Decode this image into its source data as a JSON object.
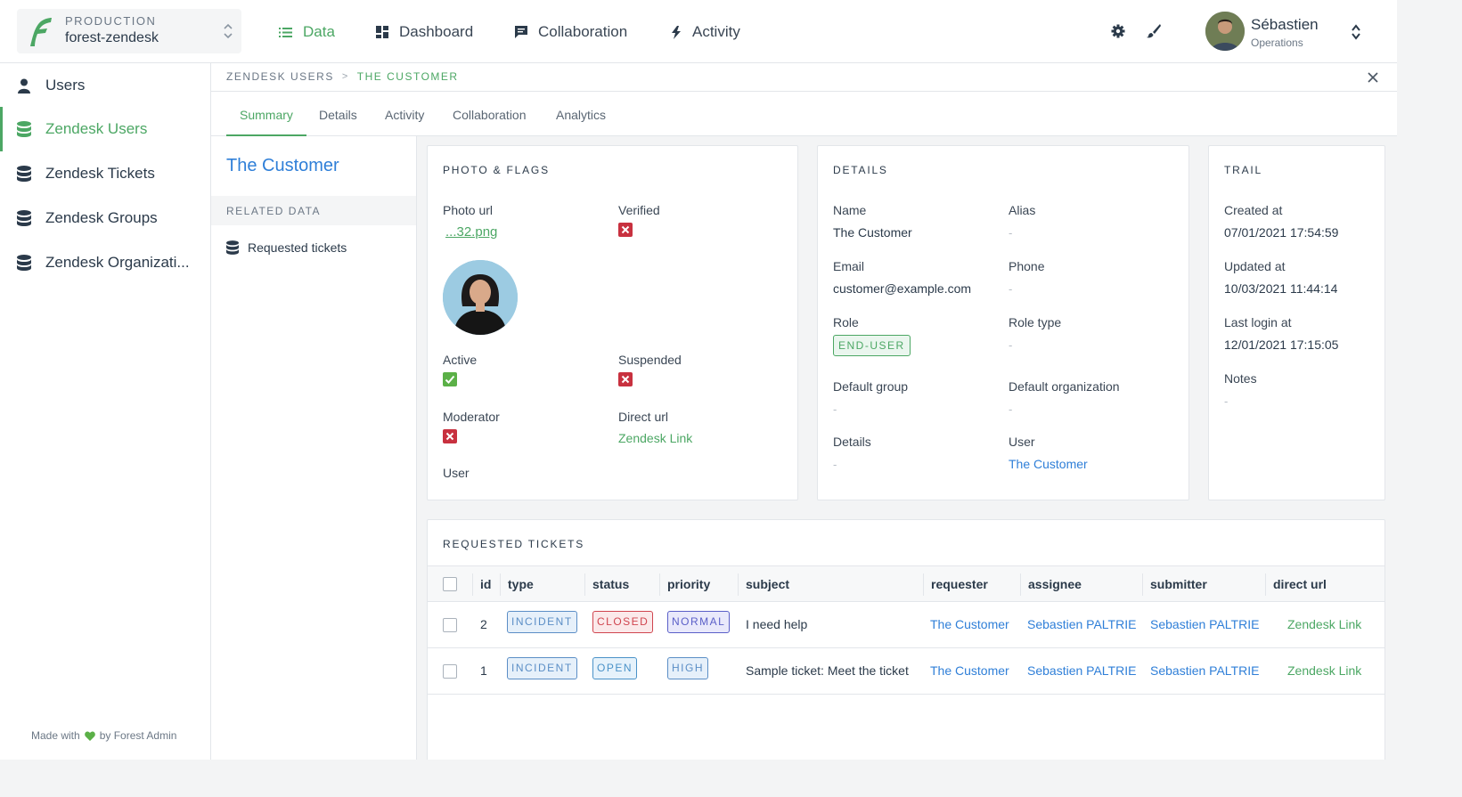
{
  "project": {
    "env": "PRODUCTION",
    "name": "forest-zendesk"
  },
  "topnav": [
    {
      "label": "Data",
      "icon": "list-icon"
    },
    {
      "label": "Dashboard",
      "icon": "dashboard-icon"
    },
    {
      "label": "Collaboration",
      "icon": "chat-icon"
    },
    {
      "label": "Activity",
      "icon": "bolt-icon"
    }
  ],
  "user": {
    "name": "Sébastien",
    "role": "Operations"
  },
  "sidebar": {
    "items": [
      {
        "label": "Users"
      },
      {
        "label": "Zendesk Users"
      },
      {
        "label": "Zendesk Tickets"
      },
      {
        "label": "Zendesk Groups"
      },
      {
        "label": "Zendesk Organizati..."
      }
    ],
    "footer_prefix": "Made with",
    "footer_suffix": "by Forest Admin"
  },
  "breadcrumb": {
    "collection": "ZENDESK USERS",
    "sep": ">",
    "record": "THE CUSTOMER"
  },
  "tabs": [
    "Summary",
    "Details",
    "Activity",
    "Collaboration",
    "Analytics"
  ],
  "record": {
    "title": "The Customer",
    "related_header": "RELATED DATA",
    "related_items": [
      "Requested tickets"
    ]
  },
  "photo_flags": {
    "title": "PHOTO & FLAGS",
    "photo_url_label": "Photo url",
    "photo_url_value": "...32.png",
    "verified_label": "Verified",
    "active_label": "Active",
    "suspended_label": "Suspended",
    "moderator_label": "Moderator",
    "direct_url_label": "Direct url",
    "direct_url_value": "Zendesk Link",
    "user_label": "User"
  },
  "details": {
    "title": "DETAILS",
    "name_label": "Name",
    "name_value": "The Customer",
    "alias_label": "Alias",
    "alias_value": "-",
    "email_label": "Email",
    "email_value": "customer@example.com",
    "phone_label": "Phone",
    "phone_value": "-",
    "role_label": "Role",
    "role_value": "END-USER",
    "role_type_label": "Role type",
    "role_type_value": "-",
    "default_group_label": "Default group",
    "default_group_value": "-",
    "default_org_label": "Default organization",
    "default_org_value": "-",
    "details_label": "Details",
    "details_value": "-",
    "user_label": "User",
    "user_value": "The Customer"
  },
  "trail": {
    "title": "TRAIL",
    "created_label": "Created at",
    "created_value": "07/01/2021 17:54:59",
    "updated_label": "Updated at",
    "updated_value": "10/03/2021 11:44:14",
    "last_login_label": "Last login at",
    "last_login_value": "12/01/2021 17:15:05",
    "notes_label": "Notes",
    "notes_value": "-"
  },
  "tickets": {
    "title": "REQUESTED TICKETS",
    "columns": [
      "id",
      "type",
      "status",
      "priority",
      "subject",
      "requester",
      "assignee",
      "submitter",
      "direct url"
    ],
    "rows": [
      {
        "id": "2",
        "type": "INCIDENT",
        "status": "CLOSED",
        "priority": "NORMAL",
        "subject": "I need help",
        "requester": "The Customer",
        "assignee": "Sebastien PALTRIE",
        "submitter": "Sebastien PALTRIE",
        "direct_url": "Zendesk Link"
      },
      {
        "id": "1",
        "type": "INCIDENT",
        "status": "OPEN",
        "priority": "HIGH",
        "subject": "Sample ticket: Meet the ticket",
        "requester": "The Customer",
        "assignee": "Sebastien PALTRIE",
        "submitter": "Sebastien PALTRIE",
        "direct_url": "Zendesk Link"
      }
    ]
  },
  "colors": {
    "accent": "#4ca764",
    "link": "#2f7fd8",
    "danger": "#c8313f",
    "success": "#5bb047"
  }
}
